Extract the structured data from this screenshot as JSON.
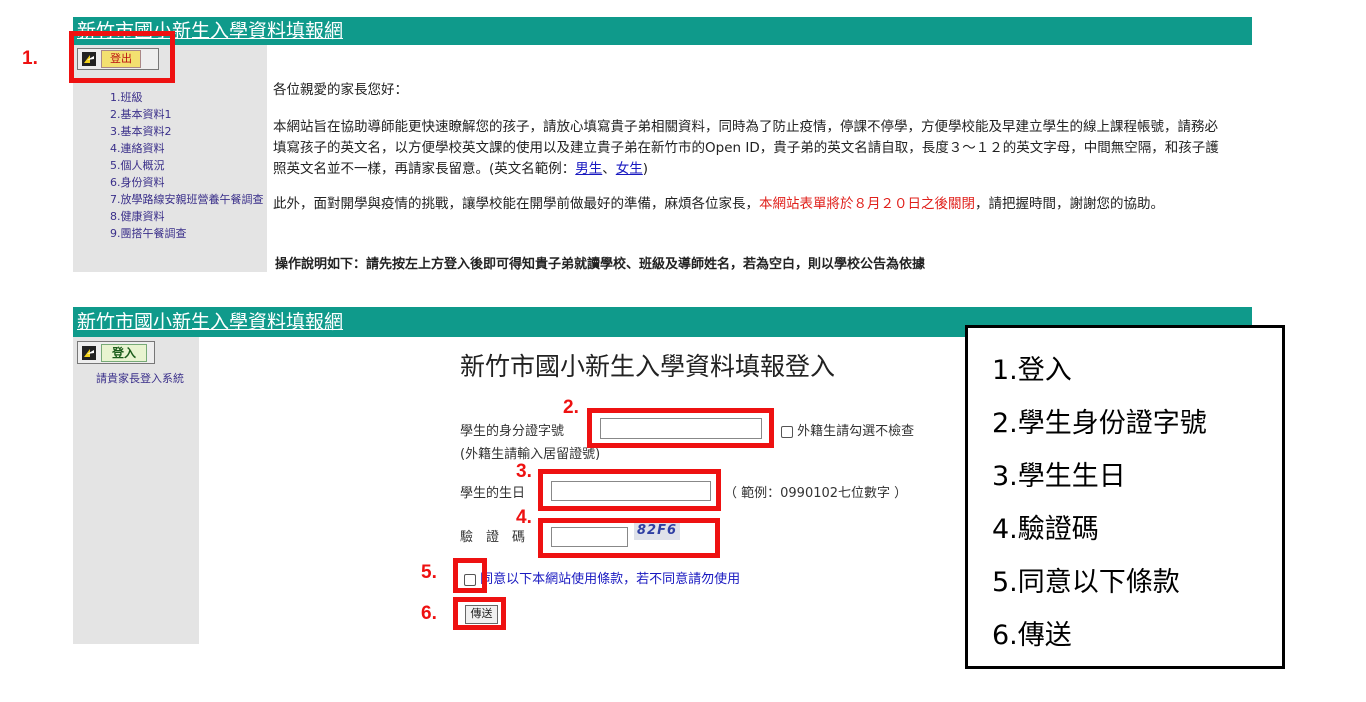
{
  "top": {
    "banner_title": "新竹市國小新生入學資料填報網",
    "logout_label": "登出",
    "menu": [
      "1.班級",
      "2.基本資料1",
      "3.基本資料2",
      "4.連絡資料",
      "5.個人概況",
      "6.身份資料",
      "7.放學路線安親班營養午餐調查",
      "8.健康資料",
      "9.團搭午餐調查"
    ],
    "greeting": "各位親愛的家長您好：",
    "para1_a": "本網站旨在協助導師能更快速瞭解您的孩子，請放心填寫貴子弟相關資料，同時為了防止疫情，停課不停學，方便學校能及早建立學生的線上課程帳號，請務必填寫孩子的英文名，以方便學校英文課的使用以及建立貴子弟在新竹市的Open ID，貴子弟的英文名請自取，長度３～１２的英文字母，中間無空隔，和孩子護照英文名並不一樣，再請家長留意。(英文名範例：",
    "para1_boy": "男生",
    "para1_sep": "、",
    "para1_girl": "女生",
    "para1_end": ")",
    "para2_a": "此外，面對開學與疫情的挑戰，讓學校能在開學前做最好的準備，麻煩各位家長，",
    "para2_red": "本網站表單將於８月２０日之後關閉",
    "para2_b": "，請把握時間，謝謝您的協助。",
    "instruction": "操作說明如下：請先按左上方登入後即可得知貴子弟就讀學校、班級及導師姓名，若為空白，則以學校公告為依據"
  },
  "login": {
    "banner_title": "新竹市國小新生入學資料填報網",
    "login_label": "登入",
    "sidebar_hint": "請貴家長登入系統",
    "form_title": "新竹市國小新生入學資料填報登入",
    "id_label": "學生的身分證字號",
    "id_value": "",
    "foreign_checkbox_label": "外籍生請勾選不檢查",
    "id_note": "(外籍生請輸入居留證號)",
    "birthday_label": "學生的生日",
    "birthday_value": "",
    "birthday_hint": "（ 範例：0990102七位數字 ）",
    "captcha_label": "驗　證　碼",
    "captcha_value": "",
    "captcha_text": "82F6",
    "agree_label": "同意以下本網站使用條款，若不同意請勿使用",
    "send_label": "傳送"
  },
  "annotations": {
    "steps": [
      "1.",
      "2.",
      "3.",
      "4.",
      "5.",
      "6."
    ],
    "legend": [
      "1.登入",
      "2.學生身份證字號",
      "3.學生生日",
      "4.驗證碼",
      "5.同意以下條款",
      "6.傳送"
    ]
  },
  "colors": {
    "banner": "#0f9a8b",
    "sidebar": "#e4e4e4",
    "highlight": "#ee1111",
    "link": "#1818c0"
  }
}
